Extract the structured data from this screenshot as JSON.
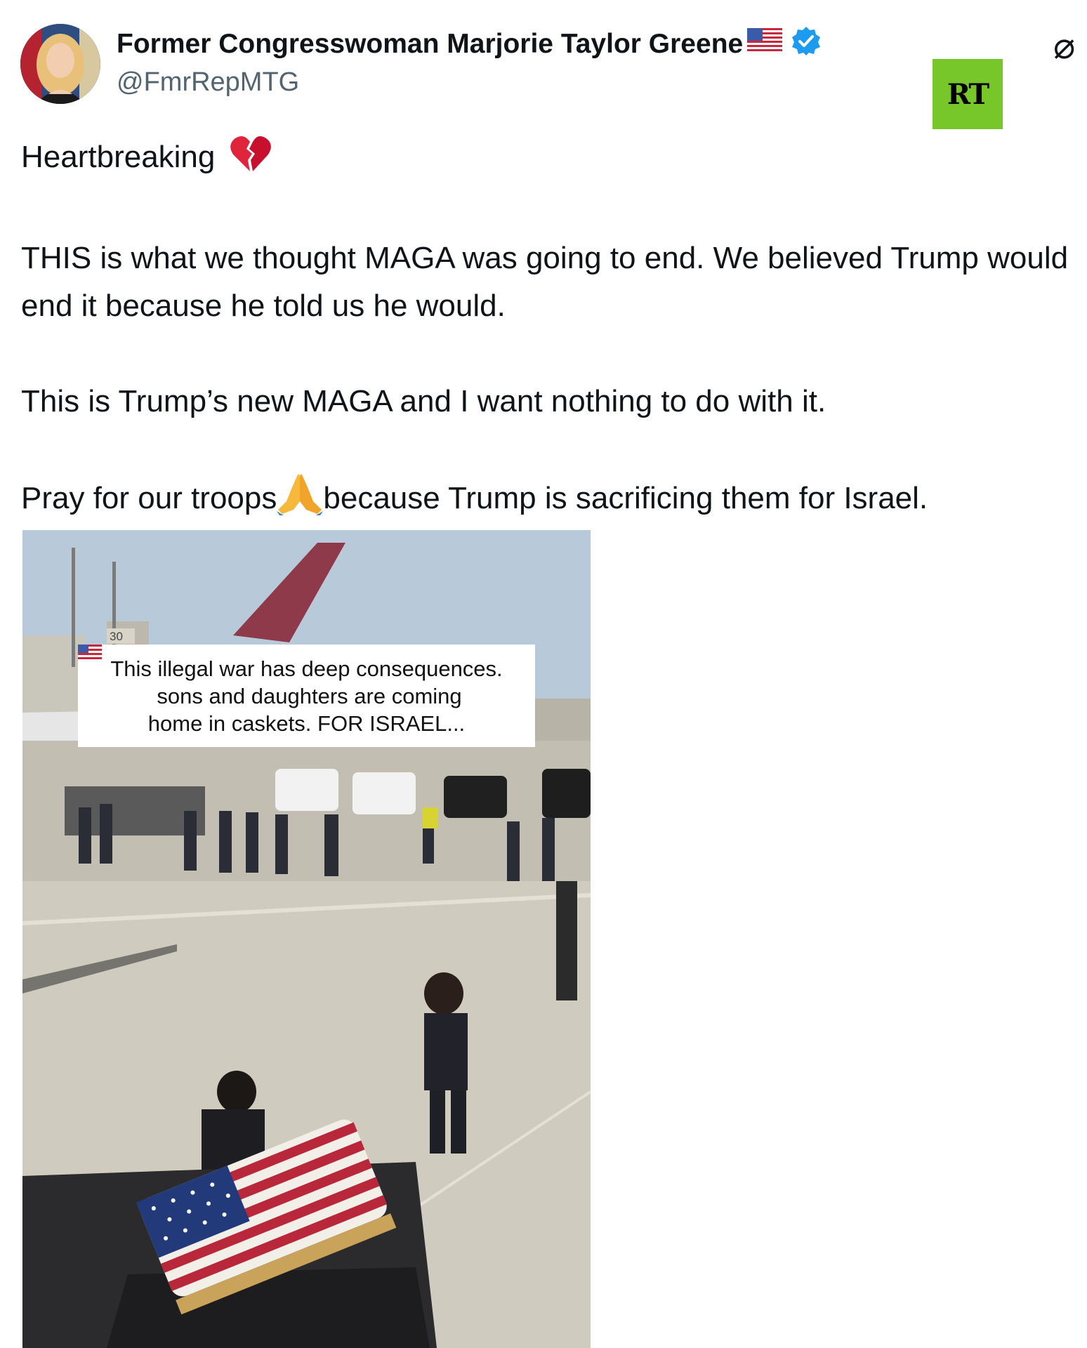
{
  "author": {
    "display_name": "Former Congresswoman Marjorie Taylor Greene",
    "handle": "@FmrRepMTG",
    "verified": true,
    "name_suffix_icon": "us-flag-icon"
  },
  "overlay_logo": {
    "text": "RT",
    "color": "#77c72b"
  },
  "corner_icon": {
    "glyph": "⌀",
    "name": "slashed-circle-icon"
  },
  "tweet": {
    "line1": "Heartbreaking",
    "line1_icon": "broken-heart-icon",
    "para2": "THIS is what we thought MAGA was going to end. We believed Trump would end it because he told us he would.",
    "para3": "This is Trump’s new MAGA and I want nothing to do with it.",
    "para4_before": "Pray for our troops",
    "para4_icon": "praying-hands-icon",
    "para4_after": "because Trump is sacrificing them for Israel."
  },
  "media": {
    "caption_line1": "This illegal war has deep consequences.",
    "caption_line2": "sons and daughters are coming",
    "caption_line2_icon": "us-flag-icon",
    "caption_line3": "home in caskets. FOR ISRAEL...",
    "sign_number": "30"
  }
}
